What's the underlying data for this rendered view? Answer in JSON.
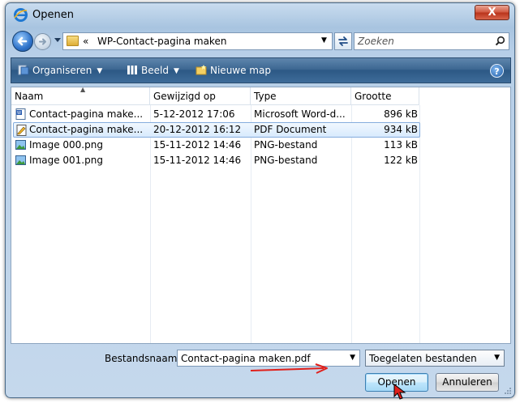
{
  "window": {
    "title": "Openen",
    "close_label": "X"
  },
  "address": {
    "crumb_sep": "«",
    "path": "WP-Contact-pagina maken",
    "search_placeholder": "Zoeken"
  },
  "toolbar": {
    "organize": "Organiseren",
    "view": "Beeld",
    "new_folder": "Nieuwe map",
    "help": "?"
  },
  "columns": {
    "name": "Naam",
    "modified": "Gewijzigd op",
    "type": "Type",
    "size": "Grootte"
  },
  "files": [
    {
      "name": "Contact-pagina make...",
      "modified": "5-12-2012 17:06",
      "type": "Microsoft Word-d...",
      "size": "896 kB",
      "icon": "word-document-icon"
    },
    {
      "name": "Contact-pagina make...",
      "modified": "20-12-2012 16:12",
      "type": "PDF Document",
      "size": "934 kB",
      "icon": "pdf-document-icon"
    },
    {
      "name": "Image 000.png",
      "modified": "15-11-2012 14:46",
      "type": "PNG-bestand",
      "size": "113 kB",
      "icon": "png-image-icon"
    },
    {
      "name": "Image 001.png",
      "modified": "15-11-2012 14:46",
      "type": "PNG-bestand",
      "size": "122 kB",
      "icon": "png-image-icon"
    }
  ],
  "footer": {
    "filename_label": "Bestandsnaam:",
    "filename_value": "Contact-pagina maken.pdf",
    "filetype": "Toegelaten bestanden",
    "open": "Openen",
    "cancel": "Annuleren"
  },
  "colors": {
    "toolbar": "#3d6792",
    "selection_border": "#84acdd",
    "annotation_arrow": "#e0201b"
  }
}
